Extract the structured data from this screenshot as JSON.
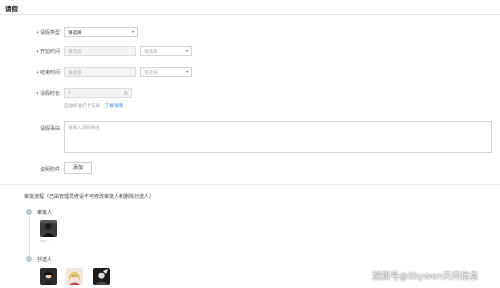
{
  "page": {
    "title": "请假"
  },
  "form": {
    "leave_type": {
      "label": "请假类型",
      "value": "请选择"
    },
    "start_time": {
      "label": "开始时间",
      "date_placeholder": "请选择",
      "period_placeholder": "请选择"
    },
    "end_time": {
      "label": "结束时间",
      "date_placeholder": "请选择",
      "period_placeholder": "请选择"
    },
    "duration": {
      "label": "请假时长",
      "value": "0",
      "unit": "天"
    },
    "duration_hint": {
      "text": "自动校准打卡记录",
      "link": "了解详情"
    },
    "reason": {
      "label": "请假事由",
      "placeholder": "请输入请假事由"
    },
    "attachment": {
      "label": "说明附件",
      "button": "添加"
    }
  },
  "approval": {
    "title": "审批流程（已由管理员修设不可修改审批人和删除抄送人）",
    "approver": {
      "label": "审批人",
      "name": "Jojo..."
    },
    "cc": {
      "label": "抄送人"
    }
  },
  "watermark": "搜狐号@Skywen天问信息",
  "colors": {
    "required": "#e0301e",
    "link": "#3a84e8",
    "node": "#b8c6d8"
  },
  "icons": {
    "dropdown": "caret-down-icon"
  }
}
